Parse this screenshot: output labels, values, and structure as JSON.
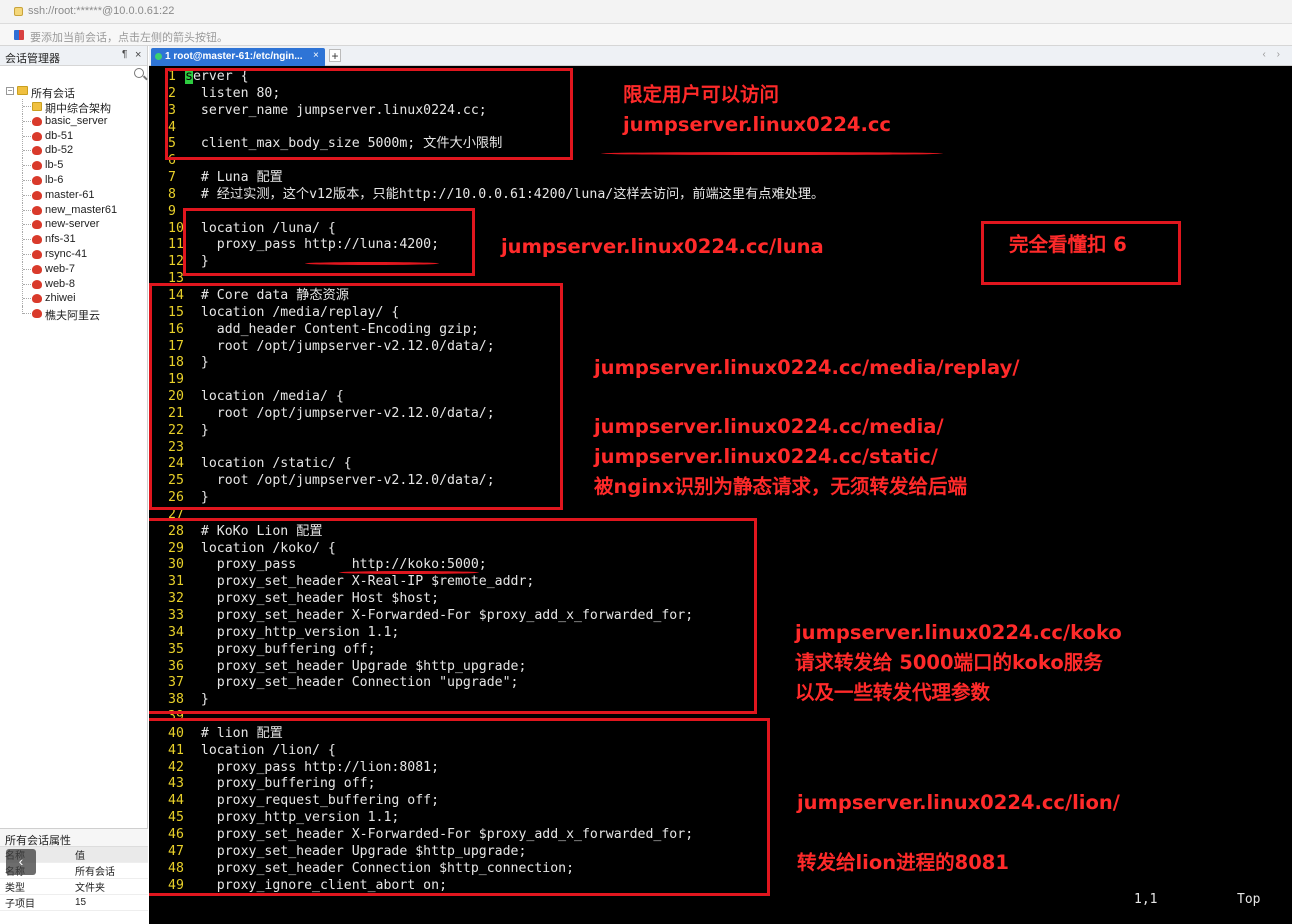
{
  "window": {
    "address": "ssh://root:******@10.0.0.61:22",
    "hint": "要添加当前会话，点击左侧的箭头按钮。"
  },
  "sidebar": {
    "title": "会话管理器",
    "pin": "¶",
    "close": "×",
    "root": "所有会话",
    "items": [
      {
        "label": "期中综合架构",
        "icon": "folder-icon"
      },
      {
        "label": "basic_server",
        "icon": "session-icon"
      },
      {
        "label": "db-51",
        "icon": "session-icon"
      },
      {
        "label": "db-52",
        "icon": "session-icon"
      },
      {
        "label": "lb-5",
        "icon": "session-icon"
      },
      {
        "label": "lb-6",
        "icon": "session-icon"
      },
      {
        "label": "master-61",
        "icon": "session-icon"
      },
      {
        "label": "new_master61",
        "icon": "session-icon"
      },
      {
        "label": "new-server",
        "icon": "session-icon"
      },
      {
        "label": "nfs-31",
        "icon": "session-icon"
      },
      {
        "label": "rsync-41",
        "icon": "session-icon"
      },
      {
        "label": "web-7",
        "icon": "session-icon"
      },
      {
        "label": "web-8",
        "icon": "session-icon"
      },
      {
        "label": "zhiwei",
        "icon": "session-icon"
      },
      {
        "label": "樵夫阿里云",
        "icon": "session-icon"
      }
    ],
    "properties": {
      "title": "所有会话属性",
      "header": [
        "名称",
        "值"
      ],
      "rows": [
        [
          "名称",
          "所有会话"
        ],
        [
          "类型",
          "文件夹"
        ],
        [
          "子项目",
          "15"
        ]
      ]
    },
    "collapse": "‹"
  },
  "tabs": [
    {
      "label": "1 root@master-61:/etc/ngin...",
      "close": "×"
    }
  ],
  "tab_plus": "+",
  "tab_nav": "‹ ›",
  "terminal": {
    "lines": [
      {
        "n": "1",
        "t": "erver {"
      },
      {
        "n": "2",
        "t": "  listen 80;"
      },
      {
        "n": "3",
        "t": "  server_name jumpserver.linux0224.cc;"
      },
      {
        "n": "4",
        "t": ""
      },
      {
        "n": "5",
        "t": "  client_max_body_size 5000m; 文件大小限制"
      },
      {
        "n": "6",
        "t": ""
      },
      {
        "n": "7",
        "t": "  # Luna 配置"
      },
      {
        "n": "8",
        "t": "  # 经过实测，这个v12版本，只能http://10.0.0.61:4200/luna/这样去访问，前端这里有点难处理。"
      },
      {
        "n": "9",
        "t": ""
      },
      {
        "n": "10",
        "t": "  location /luna/ {"
      },
      {
        "n": "11",
        "t": "    proxy_pass http://luna:4200;"
      },
      {
        "n": "12",
        "t": "  }"
      },
      {
        "n": "13",
        "t": ""
      },
      {
        "n": "14",
        "t": "  # Core data 静态资源"
      },
      {
        "n": "15",
        "t": "  location /media/replay/ {"
      },
      {
        "n": "16",
        "t": "    add_header Content-Encoding gzip;"
      },
      {
        "n": "17",
        "t": "    root /opt/jumpserver-v2.12.0/data/;"
      },
      {
        "n": "18",
        "t": "  }"
      },
      {
        "n": "19",
        "t": ""
      },
      {
        "n": "20",
        "t": "  location /media/ {"
      },
      {
        "n": "21",
        "t": "    root /opt/jumpserver-v2.12.0/data/;"
      },
      {
        "n": "22",
        "t": "  }"
      },
      {
        "n": "23",
        "t": ""
      },
      {
        "n": "24",
        "t": "  location /static/ {"
      },
      {
        "n": "25",
        "t": "    root /opt/jumpserver-v2.12.0/data/;"
      },
      {
        "n": "26",
        "t": "  }"
      },
      {
        "n": "27",
        "t": ""
      },
      {
        "n": "28",
        "t": "  # KoKo Lion 配置"
      },
      {
        "n": "29",
        "t": "  location /koko/ {"
      },
      {
        "n": "30",
        "t": "    proxy_pass       http://koko:5000;"
      },
      {
        "n": "31",
        "t": "    proxy_set_header X-Real-IP $remote_addr;"
      },
      {
        "n": "32",
        "t": "    proxy_set_header Host $host;"
      },
      {
        "n": "33",
        "t": "    proxy_set_header X-Forwarded-For $proxy_add_x_forwarded_for;"
      },
      {
        "n": "34",
        "t": "    proxy_http_version 1.1;"
      },
      {
        "n": "35",
        "t": "    proxy_buffering off;"
      },
      {
        "n": "36",
        "t": "    proxy_set_header Upgrade $http_upgrade;"
      },
      {
        "n": "37",
        "t": "    proxy_set_header Connection \"upgrade\";"
      },
      {
        "n": "38",
        "t": "  }"
      },
      {
        "n": "39",
        "t": ""
      },
      {
        "n": "40",
        "t": "  # lion 配置"
      },
      {
        "n": "41",
        "t": "  location /lion/ {"
      },
      {
        "n": "42",
        "t": "    proxy_pass http://lion:8081;"
      },
      {
        "n": "43",
        "t": "    proxy_buffering off;"
      },
      {
        "n": "44",
        "t": "    proxy_request_buffering off;"
      },
      {
        "n": "45",
        "t": "    proxy_http_version 1.1;"
      },
      {
        "n": "46",
        "t": "    proxy_set_header X-Forwarded-For $proxy_add_x_forwarded_for;"
      },
      {
        "n": "47",
        "t": "    proxy_set_header Upgrade $http_upgrade;"
      },
      {
        "n": "48",
        "t": "    proxy_set_header Connection $http_connection;"
      },
      {
        "n": "49",
        "t": "    proxy_ignore_client_abort on;"
      }
    ],
    "cursor_char": "s",
    "status_position": "1,1",
    "status_scroll": "Top"
  },
  "annotations": {
    "a1_line1": "限定用户可以访问",
    "a1_line2": "jumpserver.linux0224.cc",
    "a2": "jumpserver.linux0224.cc/luna",
    "a3": "完全看懂扣  6",
    "a4": "jumpserver.linux0224.cc/media/replay/",
    "a5_line1": "jumpserver.linux0224.cc/media/",
    "a5_line2": "jumpserver.linux0224.cc/static/",
    "a5_line3": "被nginx识别为静态请求，无须转发给后端",
    "a6_line1": "jumpserver.linux0224.cc/koko",
    "a6_line2": "请求转发给 5000端口的koko服务",
    "a6_line3": "以及一些转发代理参数",
    "a7": "jumpserver.linux0224.cc/lion/",
    "a8": "转发给lion进程的8081",
    "color": "#e0161e"
  }
}
